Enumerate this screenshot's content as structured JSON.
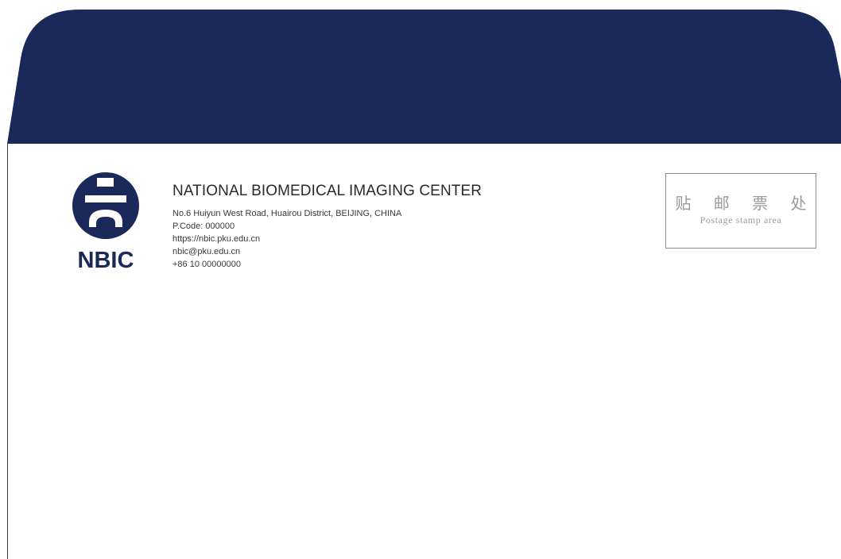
{
  "colors": {
    "brand_navy": "#1a285a",
    "page_background": "#ffffff",
    "stamp_border": "#8c8c8c",
    "stamp_text": "#9a9a9a"
  },
  "logo": {
    "wordmark": "NBIC",
    "icon": "nbic-emblem-icon"
  },
  "organization": {
    "name": "NATIONAL BIOMEDICAL IMAGING CENTER",
    "address": "No.6 Huiyun West Road, Huairou District, BEIJING, CHINA",
    "postcode": "P.Code:  000000",
    "website": "https://nbic.pku.edu.cn",
    "email": "nbic@pku.edu.cn",
    "phone": "+86 10 00000000"
  },
  "stamp_area": {
    "label_cn": "贴 邮 票 处",
    "label_en": "Postage stamp area"
  }
}
